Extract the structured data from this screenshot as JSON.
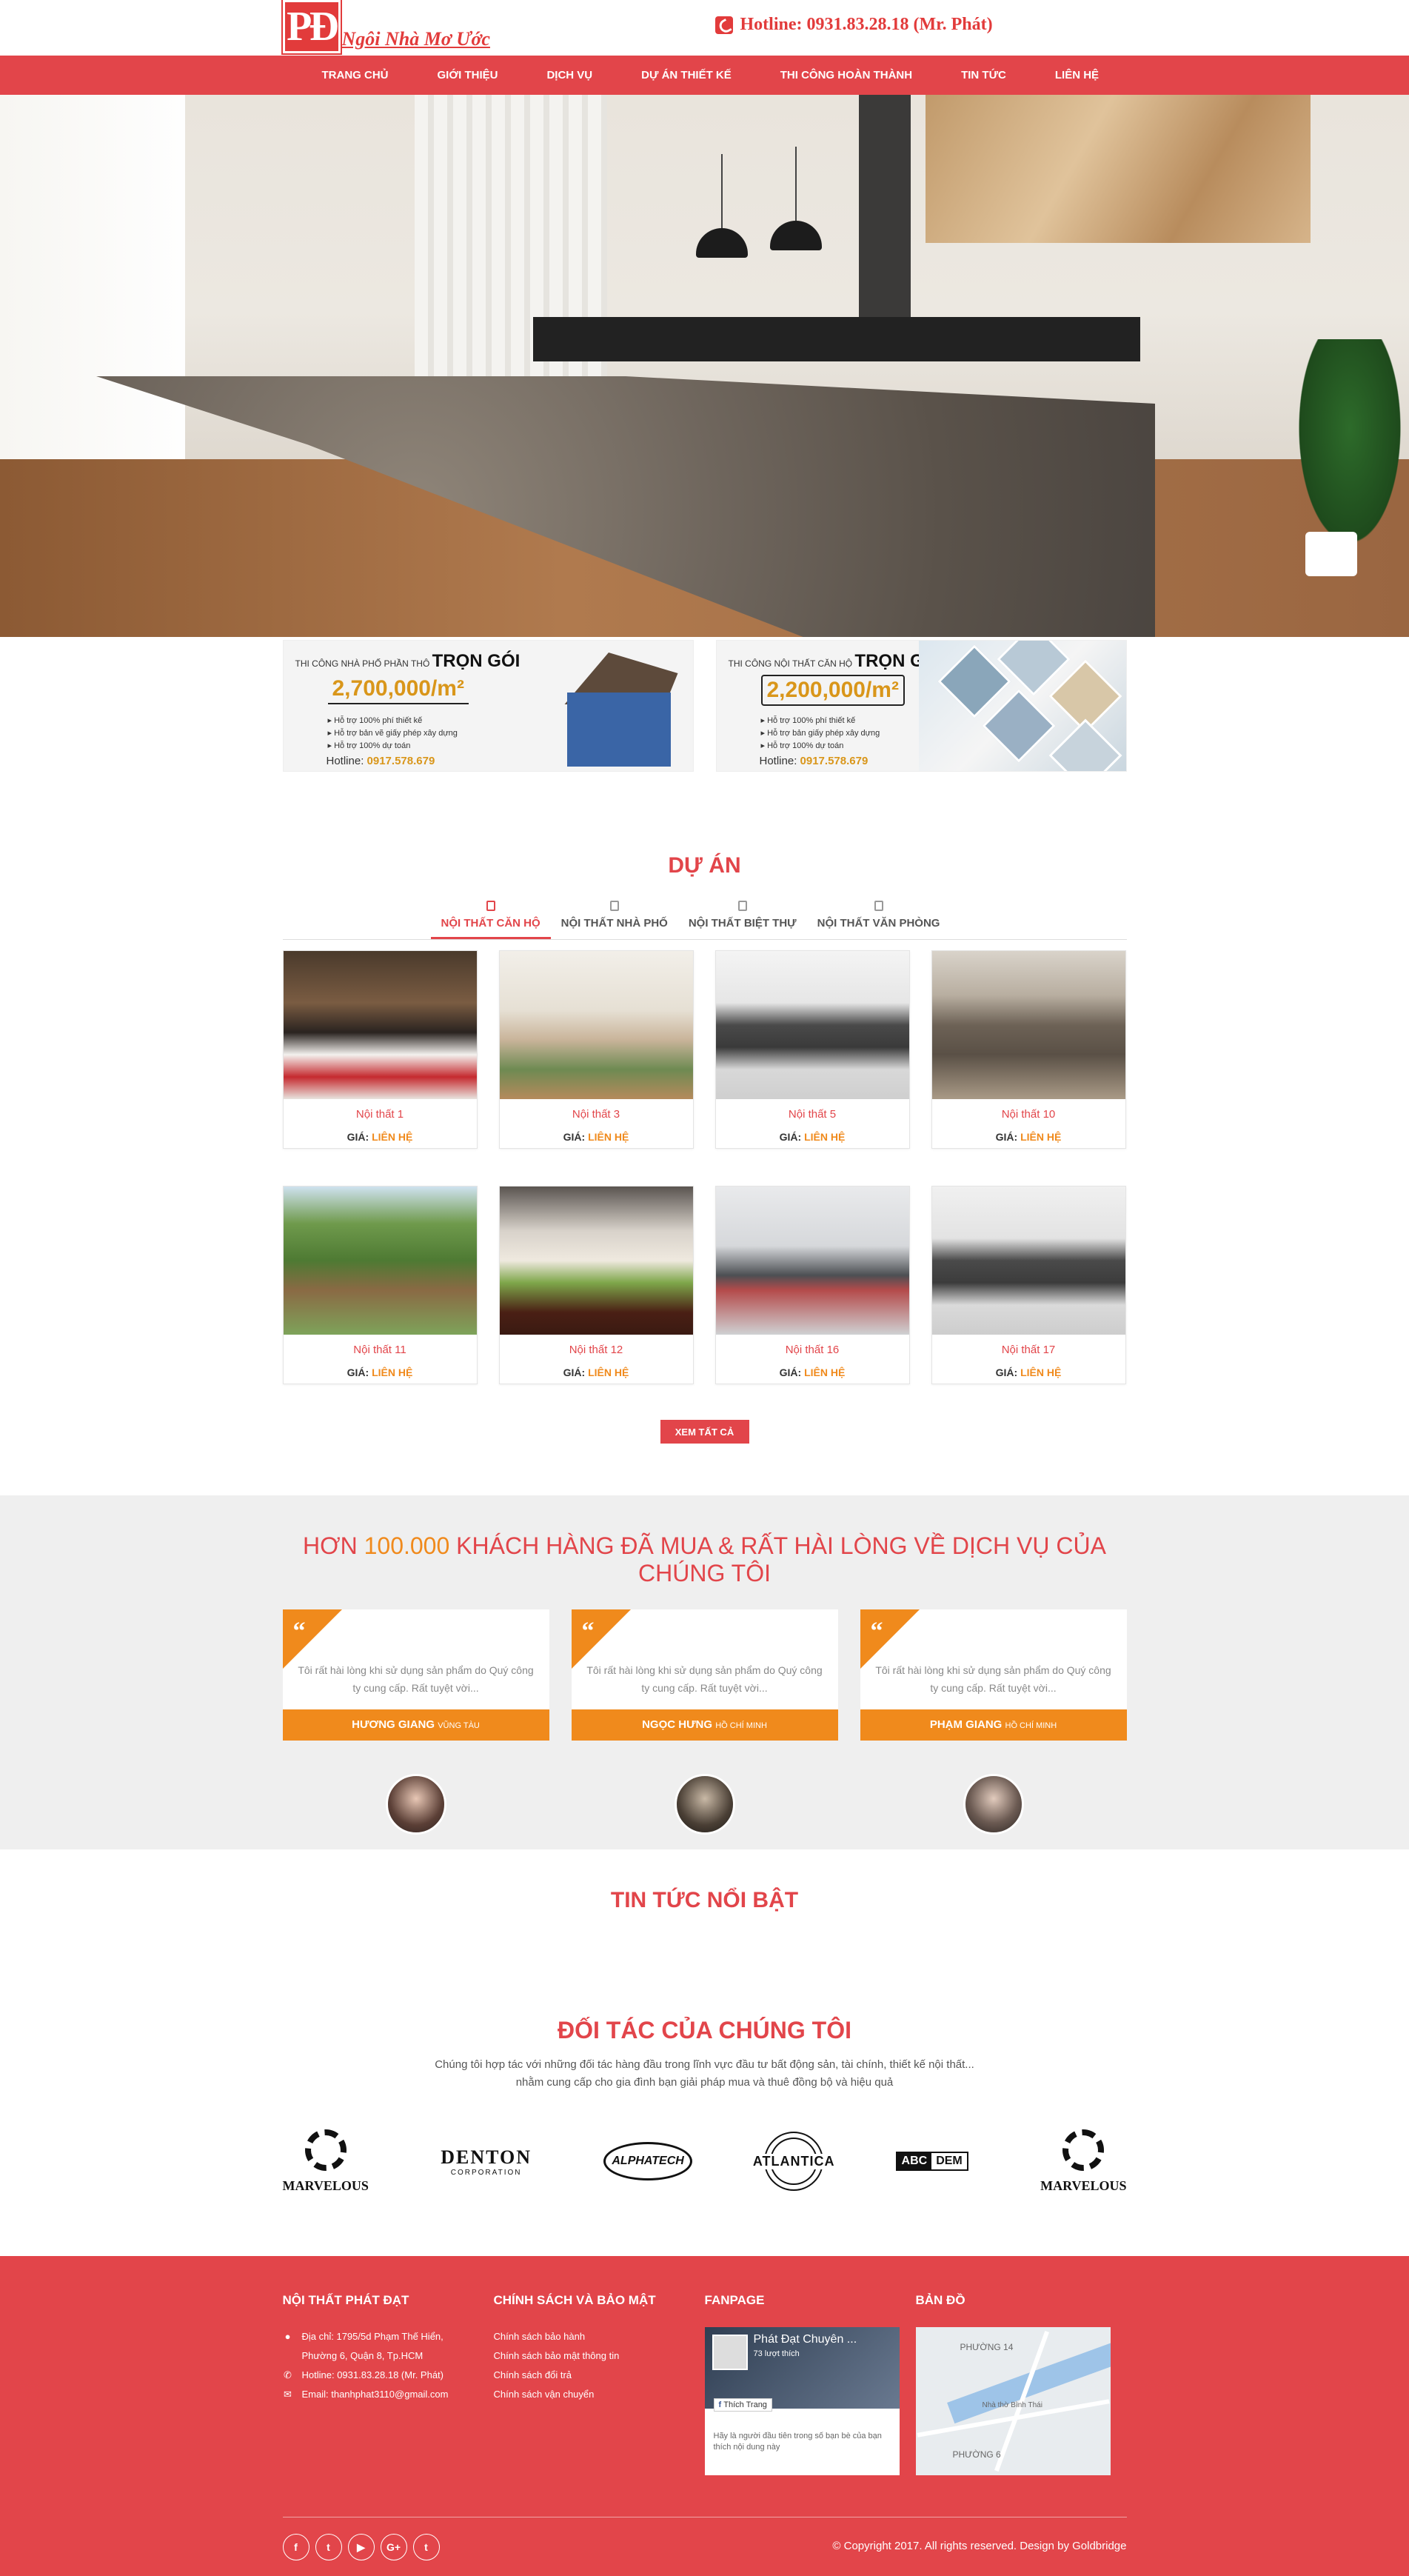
{
  "header": {
    "logo_mark": "PĐ",
    "logo_text": "Ngôi Nhà Mơ Ước",
    "hotline": "Hotline: 0931.83.28.18 (Mr. Phát)"
  },
  "nav": [
    "TRANG CHỦ",
    "GIỚI THIỆU",
    "DỊCH VỤ",
    "DỰ ÁN THIẾT KẾ",
    "THI CÔNG HOÀN THÀNH",
    "TIN TỨC",
    "LIÊN HỆ"
  ],
  "banners": [
    {
      "title": "THI CÔNG NHÀ PHỐ PHẦN THÔ",
      "title_bold": "TRỌN GÓI",
      "price": "2,700,000/m²",
      "bullets": [
        "Hỗ trợ 100% phí thiết kế",
        "Hỗ trợ bản vẽ giấy phép xây dựng",
        "Hỗ trợ 100% dự toán"
      ],
      "hotline_label": "Hotline:",
      "hotline": "0917.578.679"
    },
    {
      "title": "THI CÔNG NỘI THẤT CĂN HỘ",
      "title_bold": "TRỌN GÓI",
      "price": "2,200,000/m²",
      "bullets": [
        "Hỗ trợ 100% phí thiết kế",
        "Hỗ trợ bản giấy phép xây dựng",
        "Hỗ trợ 100% dự toán"
      ],
      "hotline_label": "Hotline:",
      "hotline": "0917.578.679"
    }
  ],
  "projects": {
    "title": "DỰ ÁN",
    "tabs": [
      "NỘI THẤT CĂN HỘ",
      "NỘI THẤT NHÀ PHỐ",
      "NỘI THẤT BIỆT THỰ",
      "NỘI THẤT VĂN PHÒNG"
    ],
    "price_label": "GIÁ:",
    "price_value": "LIÊN HỆ",
    "items": [
      "Nội thất 1",
      "Nội thất 3",
      "Nội thất 5",
      "Nội thất 10",
      "Nội thất 11",
      "Nội thất 12",
      "Nội thất 16",
      "Nội thất 17"
    ],
    "more": "XEM TẤT CẢ"
  },
  "testimonials": {
    "title_pre": "HƠN",
    "title_num": "100.000",
    "title_post": "KHÁCH HÀNG ĐÃ MUA & RẤT HÀI LÒNG VỀ DỊCH VỤ CỦA CHÚNG TÔI",
    "quote": "Tôi rất hài lòng khi sử dụng sản phẩm do Quý công ty cung cấp. Rất tuyệt vời...",
    "people": [
      {
        "name": "HƯƠNG GIANG",
        "place": "VŨNG TÀU"
      },
      {
        "name": "NGỌC HƯNG",
        "place": "HỒ CHÍ MINH"
      },
      {
        "name": "PHẠM GIANG",
        "place": "HỒ CHÍ MINH"
      }
    ]
  },
  "news": {
    "title": "TIN TỨC NỔI BẬT"
  },
  "partners": {
    "title": "ĐỐI TÁC CỦA CHÚNG TÔI",
    "desc1": "Chúng tôi hợp tác với những đối tác hàng đầu trong lĩnh vực đầu tư bất động sản, tài chính, thiết kế nội thất...",
    "desc2": "nhằm cung cấp cho gia đình bạn giải pháp mua và thuê đồng bộ và hiệu quả",
    "logos": [
      "MARVELOUS",
      "DENTON",
      "CORPORATION",
      "ALPHATECH",
      "ATLANTICA",
      "ABC",
      "DEM",
      "MARVELOUS"
    ]
  },
  "footer": {
    "col1_title": "NỘI THẤT PHÁT ĐẠT",
    "address": "Địa chỉ: 1795/5d Phạm Thế Hiển, Phường 6, Quận 8, Tp.HCM",
    "hotline": "Hotline: 0931.83.28.18 (Mr. Phát)",
    "email": "Email: thanhphat3110@gmail.com",
    "col2_title": "CHÍNH SÁCH VÀ BẢO MẬT",
    "policies": [
      "Chính sách bảo hành",
      "Chính sách bảo mật thông tin",
      "Chính sách đổi trả",
      "Chính sách vận chuyển"
    ],
    "col3_title": "FANPAGE",
    "fb_name": "Phát Đạt Chuyên ...",
    "fb_likes": "73 lượt thích",
    "fb_like_btn": "Thích Trang",
    "fb_note": "Hãy là người đầu tiên trong số bạn bè của bạn thích nội dung này",
    "col4_title": "BẢN ĐỒ",
    "map_labels": [
      "PHƯỜNG 14",
      "Nhà thờ Bình Thái",
      "PHƯỜNG 6"
    ],
    "socials": [
      "f",
      "t",
      "▶",
      "G+",
      "t"
    ],
    "copyright": "© Copyright 2017. All rights reserved. Design by Goldbridge"
  }
}
